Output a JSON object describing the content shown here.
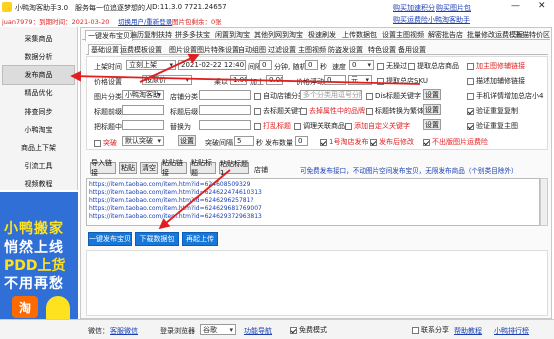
{
  "titlebar": {
    "app_name": "小鸭淘客助手3.0",
    "tagline": "服务每一位追逐梦想的人",
    "id_text": "ID:11.3.0 7721.24657",
    "minimize": "—",
    "close": "✕",
    "links": [
      "购买加速积分",
      "购买图片包",
      "购买运费险",
      "小鸭淘客助手"
    ]
  },
  "userbar": {
    "user": "juan7979：到期时间：2021-03-20",
    "switch_user": "切换用户/重新登录",
    "remaining": "图片包剩余：0张"
  },
  "sidebar": {
    "items": [
      "采集商品",
      "数据分析",
      "发布商品",
      "精品优化",
      "排查同步",
      "小鸭淘宝",
      "商品上下架",
      "引流工具",
      "视频教程"
    ],
    "active_index": 2
  },
  "ad": {
    "line1": "小鸭搬家",
    "line2": "悄然上线",
    "line3": "PDD上货",
    "line4": "不用再愁",
    "logo_char": "淘"
  },
  "tabs": [
    "一键发布宝贝",
    "遍历复制扶持",
    "拼多多扶宝",
    "闲置到淘宝",
    "其他列网到淘宝",
    "极速刷发",
    "上传数据包",
    "设置主图视频",
    "解密批告店",
    "批量修改运费模板",
    "天猫特价区"
  ],
  "subtabs": [
    "基础设置",
    "运费模板设置",
    "图片设置",
    "图片特殊设置",
    "自动组图",
    "过滤设置",
    "主图视频",
    "防盗发设置",
    "特色设置",
    "备用设置"
  ],
  "form": {
    "listing_time_label": "上架时间",
    "listing_time_value": "立刻上架",
    "datetime": "2021-02-22 12:40:10",
    "interval_label": "间隔",
    "interval_value": "0",
    "random_label": "分钟, 随机",
    "random_value": "0",
    "second_label": "秒",
    "speed_label": "速度",
    "speed_value": "0",
    "no_delay": "无操过",
    "fetch_shop_cats": "提取总店商品",
    "price_settings_label": "价格设置",
    "price_settings_value": "按原价",
    "multiply_label": "乘以",
    "multiply_value": "1.00",
    "add_label": "加上",
    "add_value": "0.00",
    "float_label": "价格浮动",
    "float_value": "0",
    "yuan": "元",
    "fetch_shop_cats2": "提取总店SKU",
    "image_class_label": "图片分类",
    "image_class_value": "小鸭淘客助",
    "shop_class_label": "店铺分类",
    "auto_shop_class": "自动店铺分类",
    "shop_class_placeholder": "多个分类用逗号分隔",
    "keyword_title": "Dis标题关键字",
    "settings1": "设置",
    "title_prefix_label": "标题前缀",
    "title_suffix_label": "标题后缀",
    "remove_title_word": "去标题关键字",
    "remove_nonsense": "去掉属性中的品牌",
    "title_unify": "标题转换为繁体",
    "settings2": "设置",
    "replace_label": "把标题中",
    "replace_with_label": "替换为",
    "random_title": "打乱标题",
    "detect_title": "调理关联商品",
    "add_custom": "添加自定义关键字",
    "settings3": "设置",
    "chk_main_pic": "加主图修辅链接",
    "chk_detail": "描述加辅修链接",
    "chk_hand": "手机详情增加总店小4",
    "chk_add_video": "验证重复复制",
    "chk_video_main": "验证重复主图",
    "chk_verify_img": "验证重复主图",
    "stock_label": "突破",
    "stock_value": "默认突破",
    "settings4": "设置",
    "break_interval_label": "突破间隔",
    "break_interval_value": "5",
    "sec": "秒",
    "shipping_label": "发布数量",
    "shipping_value": "0",
    "chk_1688": "1号淘店发布",
    "chk_after_modify": "发布后修改",
    "chk_xiaohongshu": "不出版图片运费险"
  },
  "toolbar": {
    "buttons": [
      "导入链接",
      "粘贴",
      "清空",
      "粘贴链接",
      "粘贴标题",
      "粘贴标题1"
    ],
    "shop_label": "店铺",
    "notice": "可免费发布接口，不动图片空间发布宝贝，无限发布商品（个别类目除外）"
  },
  "links_list": [
    "https://item.taobao.com/item.htm?id=624608509329",
    "https://item.taobao.com/item.htm?id=624622474610313",
    "https://item.taobao.com/item.htm?id=624629625781?",
    "https://item.taobao.com/item.htm?id=624629681769007",
    "https://item.taobao.com/item.htm?id=624629372963813"
  ],
  "actions": {
    "publish": "一键发布宝贝",
    "download": "下载数据包",
    "upload": "再起上传"
  },
  "footer": {
    "wechat_label": "微信：",
    "wechat_value": "客服微信",
    "login_browser_label": "登录浏览器",
    "browser_value": "谷歌",
    "feature_nav": "功能导航",
    "speed_mode": "免费模式",
    "link_promo": "联系分享",
    "help_tutorial": "帮助教程",
    "contact": "小鸭排行榜"
  },
  "colors": {
    "accent_blue": "#1677d8",
    "link_blue": "#1a3fb5",
    "red": "#e02020",
    "ad_yellow": "#ffe21f"
  }
}
